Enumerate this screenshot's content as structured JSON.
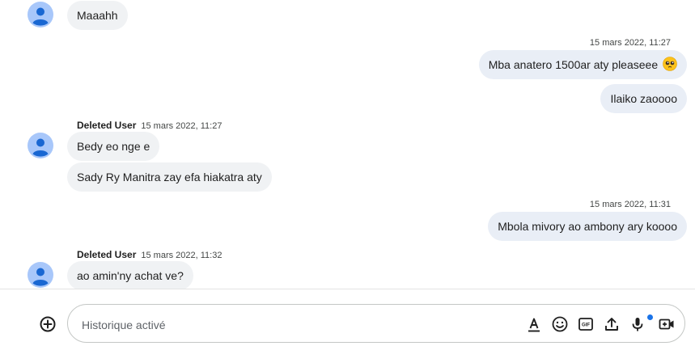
{
  "messages": [
    {
      "text": "Maaahh"
    },
    {
      "timestamp": "15 mars 2022, 11:27"
    },
    {
      "text": "Mba anatero 1500ar aty pleaseee"
    },
    {
      "text": "Ilaiko zaoooo"
    },
    {
      "sender": "Deleted User",
      "timestamp": "15 mars 2022, 11:27"
    },
    {
      "text": "Bedy eo nge e"
    },
    {
      "text": "Sady Ry Manitra zay efa hiakatra aty"
    },
    {
      "timestamp": "15 mars 2022, 11:31"
    },
    {
      "text": "Mbola mivory ao ambony ary koooo"
    },
    {
      "sender": "Deleted User",
      "timestamp": "15 mars 2022, 11:32"
    },
    {
      "text": "ao amin'ny achat ve?"
    }
  ],
  "composer": {
    "placeholder": "Historique activé",
    "tools": [
      "format-text-icon",
      "emoji-icon",
      "gif-icon",
      "upload-icon",
      "microphone-icon",
      "video-call-icon"
    ]
  },
  "colors": {
    "incoming_bubble": "#f0f2f4",
    "outgoing_bubble": "#e9eef6",
    "avatar": "#a8c7fa",
    "accent_dot": "#1a73e8"
  }
}
